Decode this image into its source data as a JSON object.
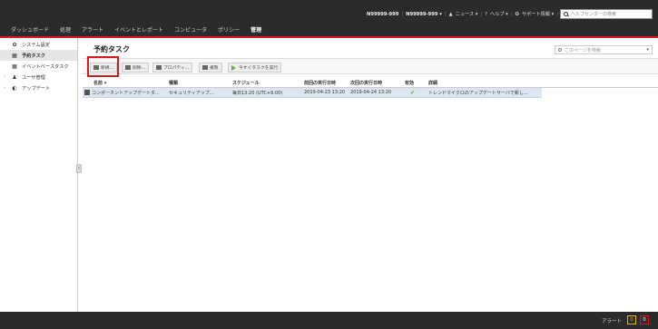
{
  "header": {
    "account": "N99999-999",
    "user": "N99999-999 ▾",
    "news": "ニュース ▾",
    "help": "ヘルプ ▾",
    "support": "サポート情報 ▾",
    "help_search_placeholder": "ヘルプセンターの検索"
  },
  "nav": [
    "ダッシュボード",
    "処理",
    "アラート",
    "イベントとレポート",
    "コンピュータ",
    "ポリシー",
    "管理"
  ],
  "sidebar": {
    "items": [
      {
        "label": "システム設定",
        "icon": "gear-icon"
      },
      {
        "label": "予約タスク",
        "icon": "calendar-icon"
      },
      {
        "label": "イベントベースタスク",
        "icon": "calendar-icon"
      },
      {
        "label": "ユーザ管理",
        "icon": "users-icon"
      },
      {
        "label": "アップデート",
        "icon": "update-icon"
      }
    ]
  },
  "page": {
    "title": "予約タスク",
    "search_placeholder": "このページを検索"
  },
  "toolbar": {
    "new": "新規...",
    "delete": "削除...",
    "properties": "プロパティ...",
    "duplicate": "複製",
    "run_now": "今すぐタスクを実行"
  },
  "table": {
    "columns": [
      "名前 ▾",
      "種類",
      "スケジュール",
      "前回の実行日時",
      "次回の実行日時",
      "有効",
      "詳細"
    ],
    "rows": [
      {
        "name": "コンポーネントアップデートタ...",
        "type": "セキュリティアップ...",
        "schedule": "毎日13:20 (UTC+9.00)",
        "last_run": "2019-04-23 13:20",
        "next_run": "2019-04-24 13:20",
        "enabled": "✔",
        "details": "トレンドマイクロのアップデートサーバで新し..."
      }
    ]
  },
  "footer": {
    "alerts_label": "アラート",
    "warning_count": "0",
    "critical_count": "0"
  }
}
